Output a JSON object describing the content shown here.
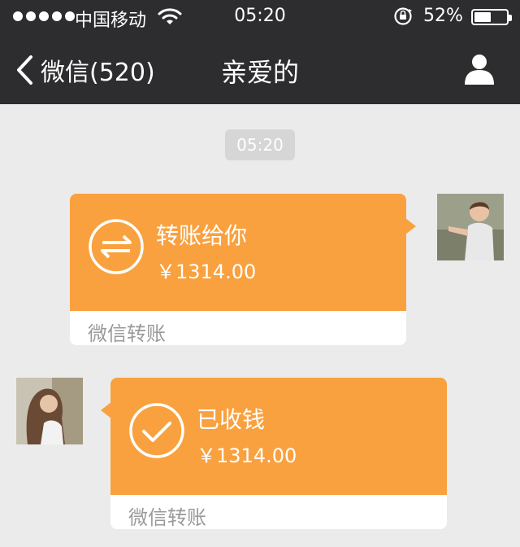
{
  "status_bar": {
    "carrier": "中国移动",
    "time": "05:20",
    "battery_percent_text": "52%",
    "battery_level": 0.52,
    "icons": [
      "signal-dots-icon",
      "wifi-icon",
      "rotation-lock-icon",
      "battery-icon"
    ]
  },
  "nav": {
    "back_label": "微信(520)",
    "title": "亲爱的",
    "icons": [
      "chevron-left-icon",
      "person-icon"
    ]
  },
  "chat": {
    "timestamp": "05:20",
    "messages": [
      {
        "sender": "me",
        "title": "转账给你",
        "amount": "￥1314.00",
        "footer": "微信转账",
        "icon": "transfer-arrows-icon"
      },
      {
        "sender": "other",
        "title": "已收钱",
        "amount": "￥1314.00",
        "footer": "微信转账",
        "icon": "checkmark-icon"
      }
    ]
  },
  "colors": {
    "bar_bg": "#2d2d2f",
    "chat_bg": "#ebebeb",
    "transfer_orange": "#f9a13f",
    "footer_text": "#9a9a9a"
  }
}
